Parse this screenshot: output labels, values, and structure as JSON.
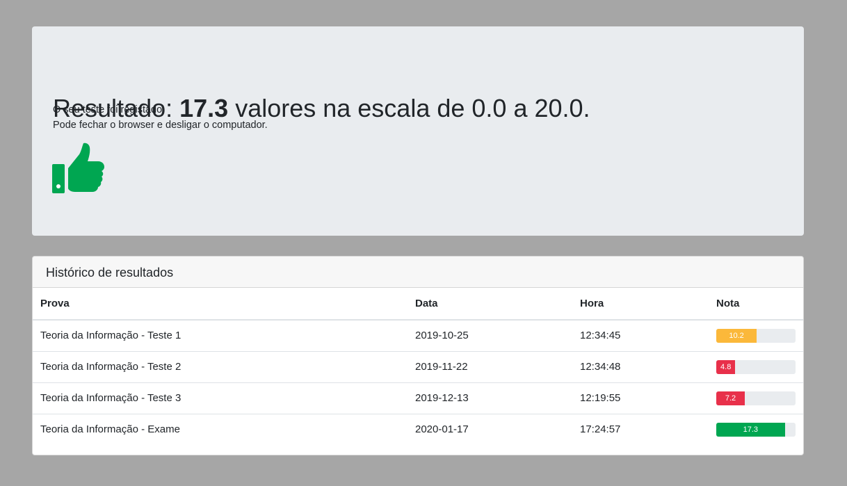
{
  "result": {
    "prefix": "Resultado: ",
    "score": "17.3",
    "suffix": " valores na escala de 0.0 a 20.0.",
    "message1": "O seu teste foi registado.",
    "message2": "Pode fechar o browser e desligar o computador.",
    "icon": "thumbs-up-icon",
    "icon_color": "#00a651"
  },
  "history": {
    "title": "Histórico de resultados",
    "columns": [
      "Prova",
      "Data",
      "Hora",
      "Nota"
    ],
    "max_score": 20,
    "rows": [
      {
        "prova": "Teoria da Informação - Teste 1",
        "data": "2019-10-25",
        "hora": "12:34:45",
        "nota": 10.2,
        "nota_label": "10.2",
        "color": "#fbb83a"
      },
      {
        "prova": "Teoria da Informação - Teste 2",
        "data": "2019-11-22",
        "hora": "12:34:48",
        "nota": 4.8,
        "nota_label": "4.8",
        "color": "#e8304a"
      },
      {
        "prova": "Teoria da Informação - Teste 3",
        "data": "2019-12-13",
        "hora": "12:19:55",
        "nota": 7.2,
        "nota_label": "7.2",
        "color": "#e8304a"
      },
      {
        "prova": "Teoria da Informação - Exame",
        "data": "2020-01-17",
        "hora": "17:24:57",
        "nota": 17.3,
        "nota_label": "17.3",
        "color": "#00a651"
      }
    ]
  }
}
